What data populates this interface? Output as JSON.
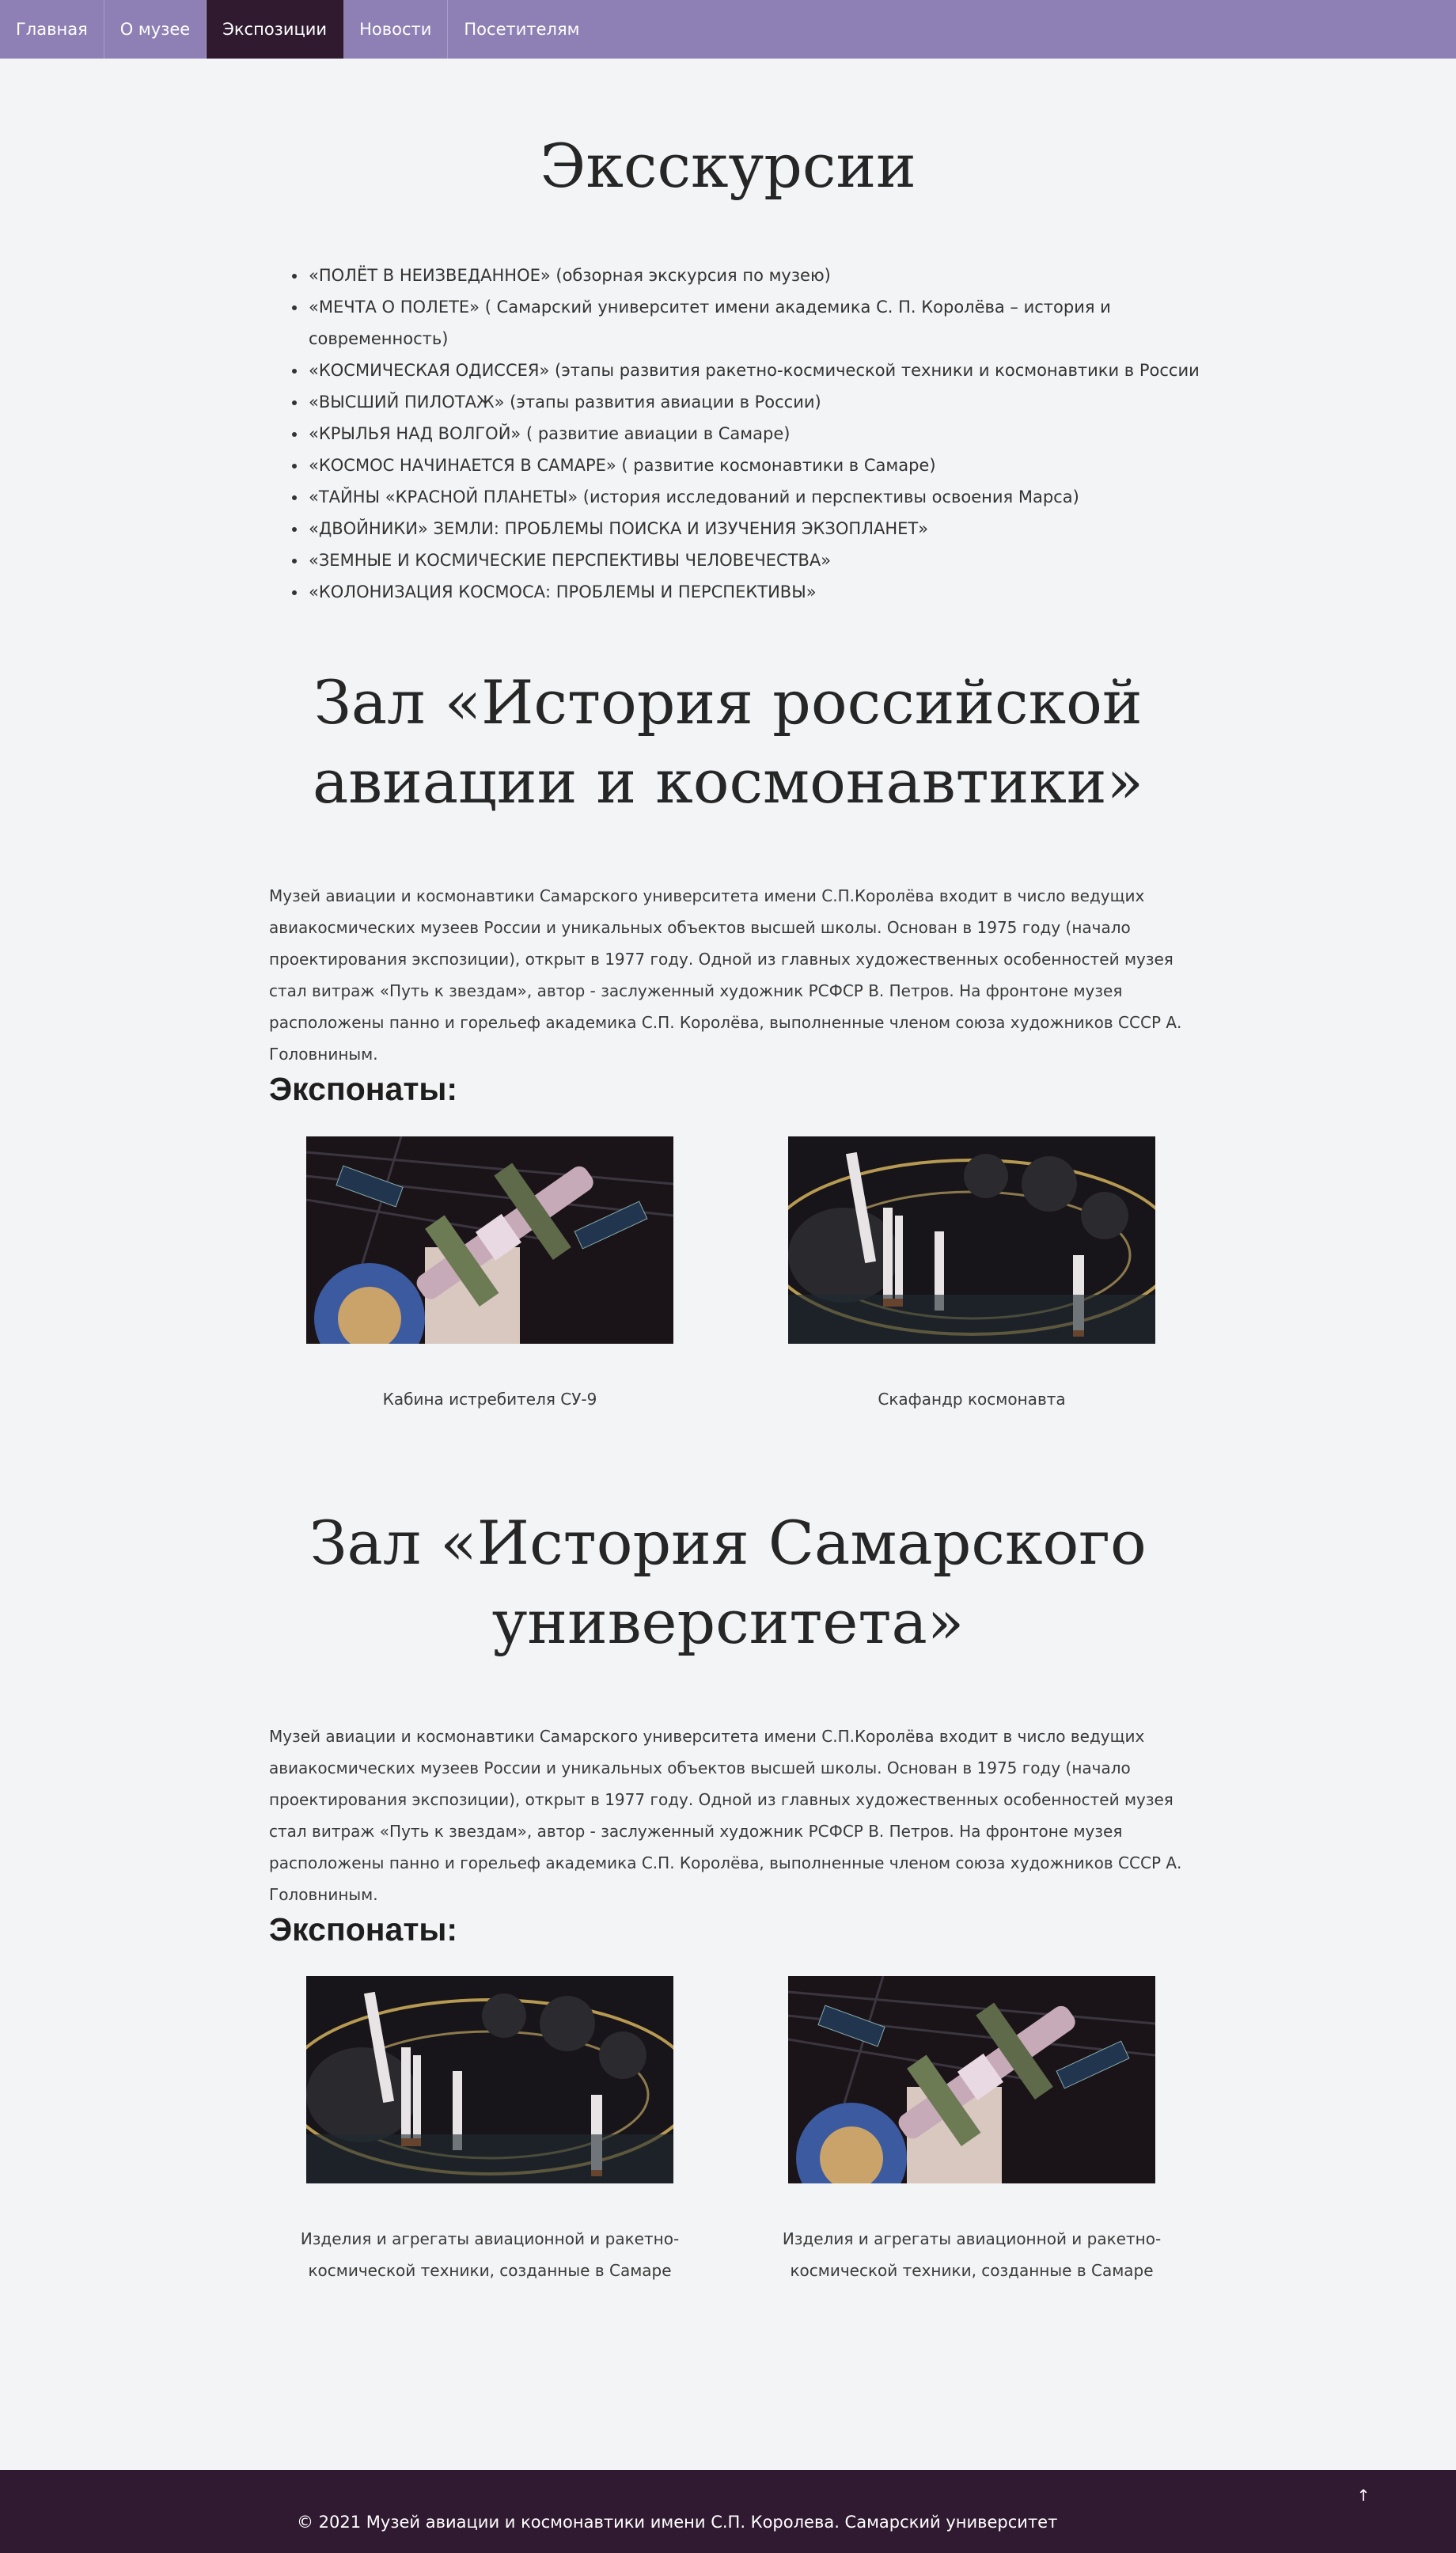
{
  "nav": {
    "items": [
      {
        "label": "Главная"
      },
      {
        "label": "О музее"
      },
      {
        "label": "Экспозиции"
      },
      {
        "label": "Новости"
      },
      {
        "label": "Посетителям"
      }
    ]
  },
  "excursions": {
    "title": "Эксскурсии",
    "items": [
      "«ПОЛЁТ В НЕИЗВЕДАННОЕ» (обзорная экскурсия по музею)",
      "«МЕЧТА О ПОЛЕТЕ» ( Самарский университет имени академика С. П. Королёва – история и современность)",
      "«КОСМИЧЕСКАЯ ОДИССЕЯ» (этапы развития ракетно-космической техники и космонавтики в России",
      "«ВЫСШИЙ ПИЛОТАЖ» (этапы развития авиации в России)",
      "«КРЫЛЬЯ НАД ВОЛГОЙ» ( развитие авиации в Самаре)",
      "«КОСМОС НАЧИНАЕТСЯ В САМАРЕ» ( развитие космонавтики в Самаре)",
      "«ТАЙНЫ «КРАСНОЙ ПЛАНЕТЫ» (история исследований и перспективы освоения Марса)",
      "«ДВОЙНИКИ» ЗЕМЛИ: ПРОБЛЕМЫ ПОИСКА И ИЗУЧЕНИЯ ЭКЗОПЛАНЕТ»",
      "«ЗЕМНЫЕ И КОСМИЧЕСКИЕ ПЕРСПЕКТИВЫ ЧЕЛОВЕЧЕСТВА»",
      "«КОЛОНИЗАЦИЯ КОСМОСА: ПРОБЛЕМЫ И ПЕРСПЕКТИВЫ»"
    ]
  },
  "hall1": {
    "title_line1": "Зал «История российской",
    "title_line2": "авиации и космонавтики»",
    "text": "Музей авиации и космонавтики Самарского университета имени С.П.Королёва входит в число ведущих авиакосмических музеев России и уникальных объектов высшей школы. Основан в 1975 году (начало проектирования экспозиции), открыт в 1977 году. Одной из главных художественных особенностей музея стал витраж «Путь к звездам», автор - заслуженный художник РСФСР В. Петров. На фронтоне музея расположены панно и горельеф академика С.П. Королёва, выполненные членом союза художников СССР А. Головниным.",
    "exhibits_heading": "Экспонаты:",
    "exhibits": [
      {
        "caption": "Кабина истребителя СУ-9"
      },
      {
        "caption": "Скафандр космонавта"
      }
    ]
  },
  "hall2": {
    "title_line1": "Зал «История Самарского",
    "title_line2": "университета»",
    "text": "Музей авиации и космонавтики Самарского университета имени С.П.Королёва входит в число ведущих авиакосмических музеев России и уникальных объектов высшей школы. Основан в 1975 году (начало проектирования экспозиции), открыт в 1977 году. Одной из главных художественных особенностей музея стал витраж «Путь к звездам», автор - заслуженный художник РСФСР В. Петров. На фронтоне музея расположены панно и горельеф академика С.П. Королёва, выполненные членом союза художников СССР А. Головниным.",
    "exhibits_heading": "Экспонаты:",
    "exhibits": [
      {
        "caption": "Изделия и агрегаты авиационной и ракетно-космической техники, созданные в Самаре"
      },
      {
        "caption": "Изделия и агрегаты авиационной и ракетно-космической техники, созданные в Самаре"
      }
    ]
  },
  "footer": {
    "copyright": "© 2021 Музей авиации и космонавтики имени С.П. Королева. Самарский университет",
    "to_top": "↑"
  },
  "colors": {
    "nav_bg": "#8e80b4",
    "nav_active": "#2f1a30",
    "footer_bg": "#301a31",
    "page_bg": "#f3f4f6"
  }
}
